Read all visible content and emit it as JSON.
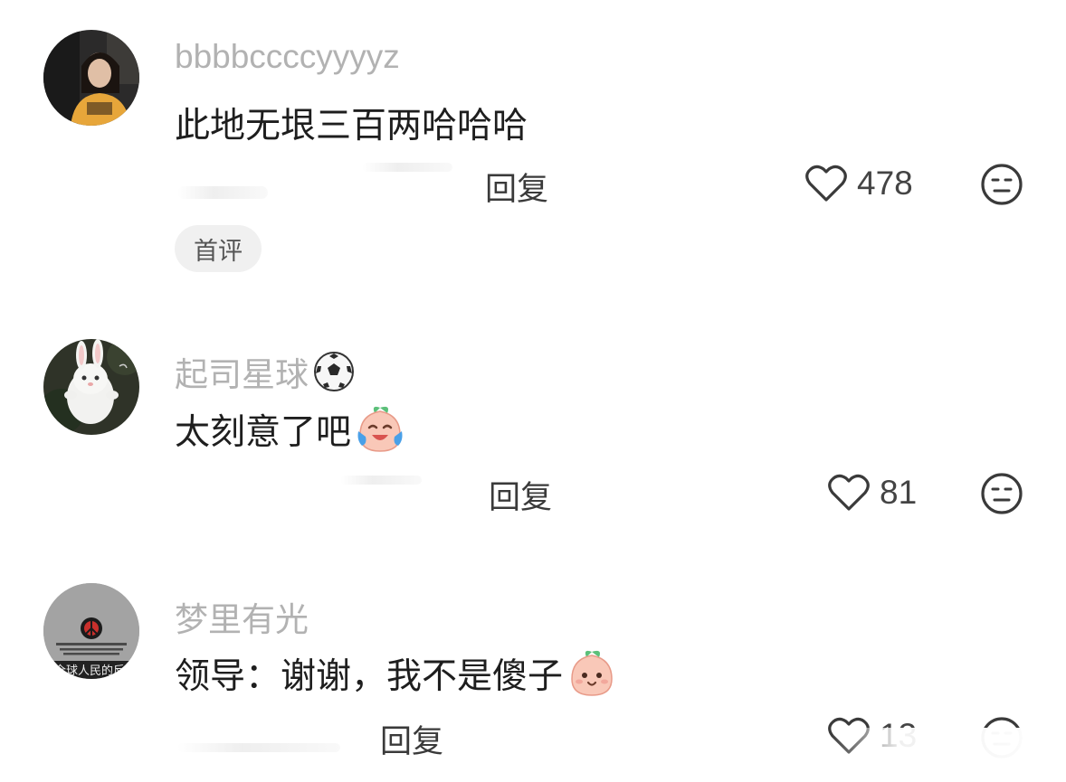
{
  "comments": [
    {
      "username": "bbbbccccyyyyz",
      "text": "此地无垠三百两哈哈哈",
      "reply_label": "回复",
      "likes": "478",
      "badge": "首评"
    },
    {
      "username": "起司星球",
      "text": "太刻意了吧",
      "reply_label": "回复",
      "likes": "81"
    },
    {
      "username": "梦里有光",
      "text": "领导：谢谢，我不是傻子",
      "reply_label": "回复",
      "likes": "13"
    }
  ],
  "avatar3_caption": "全球人民的反",
  "icons": {
    "like": "heart-outline-icon",
    "dislike": "meh-face-icon",
    "username_emoji": "soccer-ball-icon",
    "emoji_cry_laugh": "peach-crying-laughing-emoji",
    "emoji_smile": "peach-smile-emoji"
  },
  "colors": {
    "username": "#b2b2b2",
    "text": "#1e1e1e",
    "badge_bg": "#f0f0f0"
  }
}
